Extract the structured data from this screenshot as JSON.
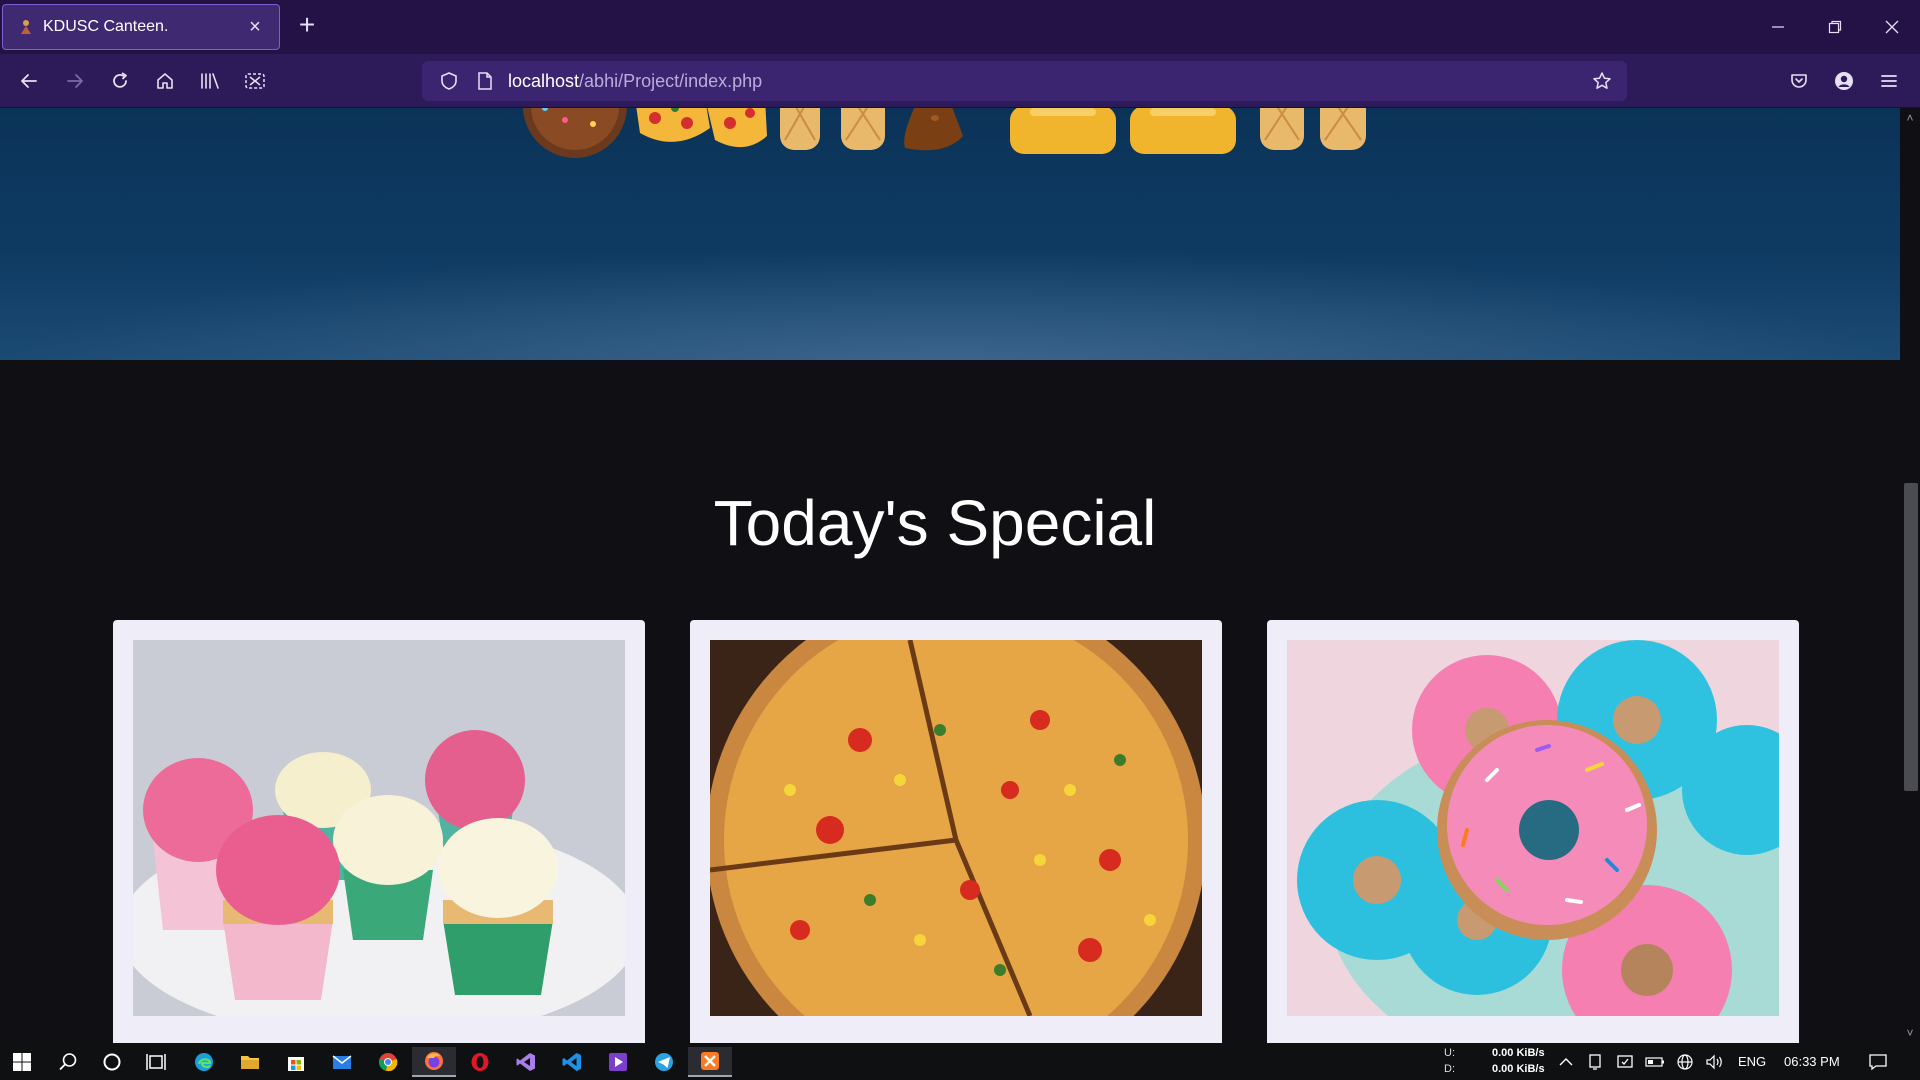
{
  "browser": {
    "tab_title": "KDUSC Canteen.",
    "url_host": "localhost",
    "url_path": "/abhi/Project/index.php",
    "accent": "#2d1a59"
  },
  "page": {
    "section_title": "Today's Special",
    "cards": [
      {
        "name": "cupcakes"
      },
      {
        "name": "pizza"
      },
      {
        "name": "donuts"
      }
    ]
  },
  "taskbar": {
    "upload_label": "U:",
    "download_label": "D:",
    "upload_speed": "0.00 KiB/s",
    "download_speed": "0.00 KiB/s",
    "language": "ENG",
    "time": "06:33 PM",
    "apps": [
      "start-icon",
      "search-icon",
      "cortana-icon",
      "task-view-icon",
      "edge-icon",
      "file-explorer-icon",
      "store-icon",
      "mail-icon",
      "chrome-icon",
      "firefox-icon",
      "opera-icon",
      "visual-studio-icon",
      "vscode-icon",
      "media-icon",
      "telegram-icon",
      "xampp-icon"
    ]
  }
}
